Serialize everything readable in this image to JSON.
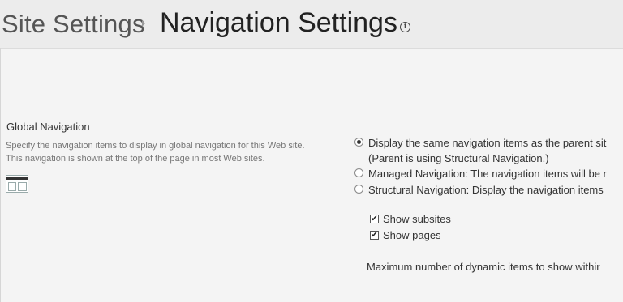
{
  "header": {
    "breadcrumb_parent": "Site Settings",
    "page_title": "Navigation Settings",
    "info_icon": "info-icon"
  },
  "global_navigation": {
    "title": "Global Navigation",
    "description": "Specify the navigation items to display in global navigation for this Web site. This navigation is shown at the top of the page in most Web sites.",
    "options": [
      {
        "label": "Display the same navigation items as the parent sit",
        "sub": "(Parent is using Structural Navigation.)",
        "checked": true
      },
      {
        "label": "Managed Navigation: The navigation items will be r",
        "checked": false
      },
      {
        "label": "Structural Navigation: Display the navigation items",
        "checked": false
      }
    ],
    "show_subsites": {
      "label": "Show subsites",
      "checked": true
    },
    "show_pages": {
      "label": "Show pages",
      "checked": true
    },
    "max_items_label": "Maximum number of dynamic items to show withir"
  }
}
